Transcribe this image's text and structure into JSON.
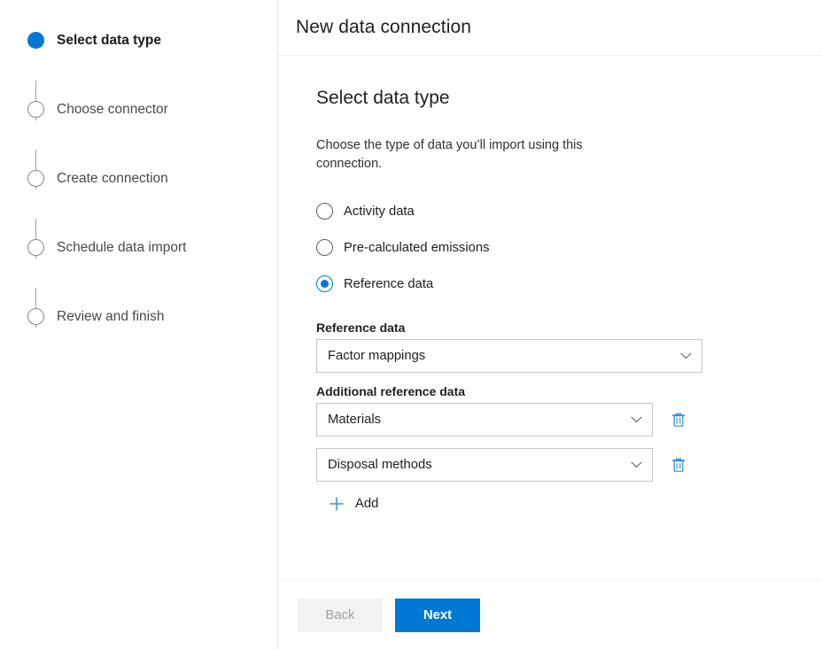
{
  "window": {
    "title": "New data connection"
  },
  "wizard": {
    "steps": [
      {
        "label": "Select data type",
        "state": "active"
      },
      {
        "label": "Choose connector",
        "state": "pending"
      },
      {
        "label": "Create connection",
        "state": "pending"
      },
      {
        "label": "Schedule data import",
        "state": "pending"
      },
      {
        "label": "Review and finish",
        "state": "pending"
      }
    ]
  },
  "main": {
    "heading": "Select data type",
    "description": "Choose the type of data you’ll import using this connection.",
    "radio_options": [
      {
        "label": "Activity data",
        "selected": false
      },
      {
        "label": "Pre-calculated emissions",
        "selected": false
      },
      {
        "label": "Reference data",
        "selected": true
      }
    ],
    "reference_data": {
      "label": "Reference data",
      "value": "Factor mappings"
    },
    "additional_reference_data": {
      "label": "Additional reference data",
      "rows": [
        {
          "value": "Materials",
          "delete_title": "Delete"
        },
        {
          "value": "Disposal methods",
          "delete_title": "Delete"
        }
      ],
      "add_label": "Add"
    }
  },
  "footer": {
    "back_label": "Back",
    "next_label": "Next"
  },
  "colors": {
    "accent": "#0078d4",
    "border": "#c8c6c4",
    "divider": "#f3f2f1",
    "text": "#201f1e",
    "muted": "#605e5c",
    "disabled_bg": "#f3f2f1",
    "disabled_text": "#a19f9d"
  }
}
